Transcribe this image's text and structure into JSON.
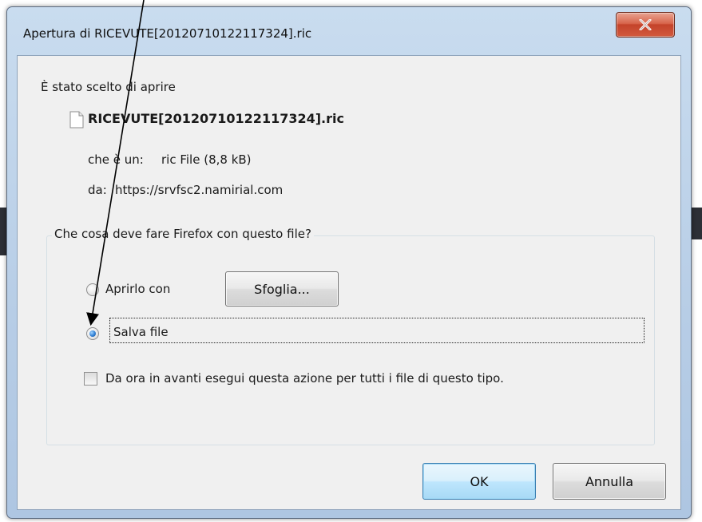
{
  "window": {
    "title": "Apertura di RICEVUTE[20120710122117324].ric",
    "close_icon": "close-x-icon"
  },
  "dialog": {
    "intro": "È stato scelto di aprire",
    "file_name": "RICEVUTE[20120710122117324].ric",
    "file_icon": "document-icon",
    "type_label": "che è un:",
    "type_value": "ric File (8,8 kB)",
    "from_label": "da:",
    "from_value": "https://srvfsc2.namirial.com"
  },
  "action_group": {
    "legend": "Che cosa deve fare Firefox con questo file?",
    "open_with_label": "Aprirlo con",
    "browse_button": "Sfoglia...",
    "save_label": "Salva file",
    "selected": "save",
    "remember_label": "Da ora in avanti esegui questa azione per tutti i file di questo tipo.",
    "remember_checked": false
  },
  "buttons": {
    "ok": "OK",
    "cancel": "Annulla"
  },
  "colors": {
    "frame": "#b7cde6",
    "close_button": "#c4432a",
    "client": "#f0f0f0",
    "default_button": "#bee6fd"
  }
}
